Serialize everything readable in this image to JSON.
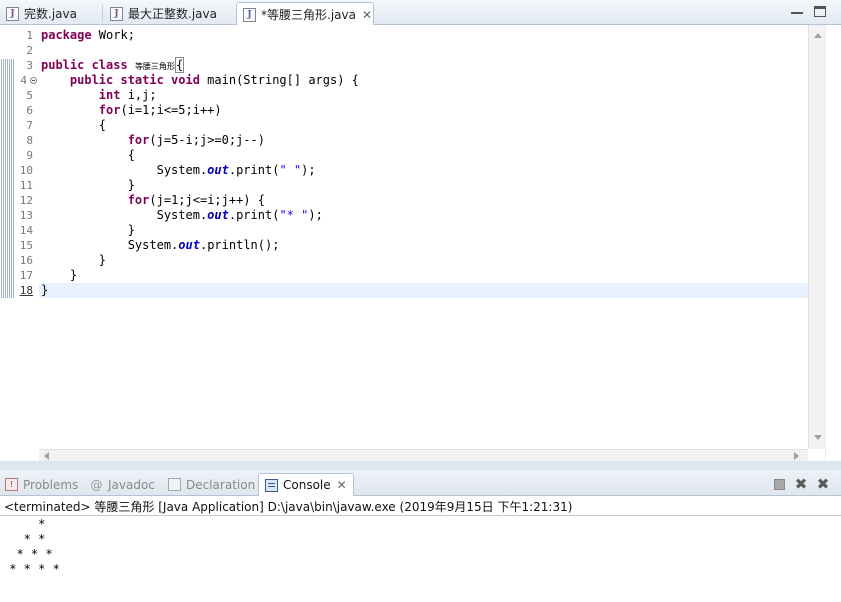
{
  "editor_tabs": [
    {
      "label": "完数.java",
      "active": false,
      "closable": false
    },
    {
      "label": "最大正整数.java",
      "active": false,
      "closable": false
    },
    {
      "label": "*等腰三角形.java",
      "active": true,
      "closable": true
    }
  ],
  "tab_close_glyph": "✕",
  "file_icon_glyph": "J",
  "editor": {
    "current_line": 18,
    "line_numbers": [
      "1",
      "2",
      "3",
      "4",
      "5",
      "6",
      "7",
      "8",
      "9",
      "10",
      "11",
      "12",
      "13",
      "14",
      "15",
      "16",
      "17",
      "18"
    ],
    "code": {
      "l1_kw": "package",
      "l1_rest": " Work;",
      "l3_kw": "public class",
      "l3_name": "等腰三角形",
      "l3_brace": "{",
      "l4_indent": "    ",
      "l4_kw": "public static void",
      "l4_rest": " main(String[] args) {",
      "l5_indent": "        ",
      "l5_kw": "int",
      "l5_rest": " i,j;",
      "l6_indent": "        ",
      "l6_kw": "for",
      "l6_rest": "(i=1;i<=5;i++)",
      "l7": "        {",
      "l8_indent": "            ",
      "l8_kw": "for",
      "l8_rest": "(j=5-i;j>=0;j--)",
      "l9": "            {",
      "l10_a": "                System.",
      "l10_fld": "out",
      "l10_b": ".print(",
      "l10_str": "\" \"",
      "l10_c": ");",
      "l11": "            }",
      "l12_indent": "            ",
      "l12_kw": "for",
      "l12_rest": "(j=1;j<=i;j++) {",
      "l13_a": "                System.",
      "l13_fld": "out",
      "l13_b": ".print(",
      "l13_str": "\"* \"",
      "l13_c": ");",
      "l14": "            }",
      "l15_a": "            System.",
      "l15_fld": "out",
      "l15_b": ".println();",
      "l16": "        }",
      "l17": "    }",
      "l18": "}"
    }
  },
  "views": {
    "tabs": [
      {
        "label": "Problems",
        "active": false
      },
      {
        "label": "Javadoc",
        "active": false
      },
      {
        "label": "Declaration",
        "active": false
      },
      {
        "label": "Console",
        "active": true
      }
    ],
    "javadoc_glyph": "@",
    "close_glyph": "✕",
    "remove_glyph": "✖"
  },
  "console": {
    "header": "<terminated> 等腰三角形 [Java Application] D:\\java\\bin\\javaw.exe (2019年9月15日 下午1:21:31)",
    "output": [
      "     * ",
      "   * * ",
      "  * * * ",
      " * * * * "
    ]
  },
  "colors": {
    "keyword": "#7f0055",
    "field": "#0000c0",
    "string": "#2a00ff",
    "current_line": "#e8f2fe"
  }
}
